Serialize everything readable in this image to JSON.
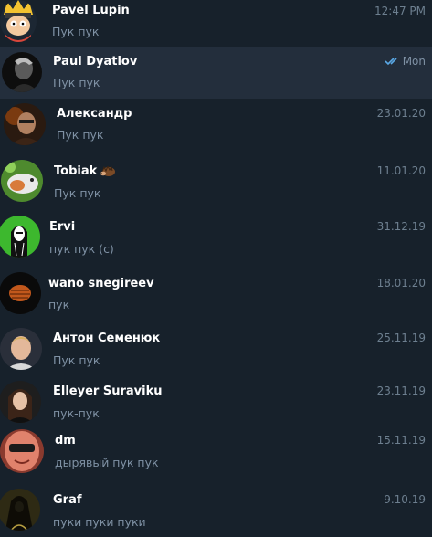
{
  "chats": [
    {
      "name": "Pavel Lupin",
      "message": "Пук пук",
      "time": "12:47 PM",
      "avatar": "cartoon-avatar"
    },
    {
      "name": "Paul Dyatlov",
      "message": "Пук пук",
      "time": "Mon",
      "avatar": "dark-portrait-avatar",
      "read_status": "double-check-icon"
    },
    {
      "name": "Александр",
      "message": "Пук пук",
      "time": "23.01.20",
      "avatar": "fire-portrait-avatar"
    },
    {
      "name": "Tobiak",
      "message": "Пук пук",
      "time": "11.01.20",
      "avatar": "bird-avatar",
      "name_emoji": "hedgehog-emoji"
    },
    {
      "name": "Ervi",
      "message": "пук пук (c)",
      "time": "31.12.19",
      "avatar": "green-figure-avatar"
    },
    {
      "name": "wano snegireev",
      "message": "пук",
      "time": "18.01.20",
      "avatar": "orange-orb-avatar"
    },
    {
      "name": "Антон Семенюк",
      "message": "Пук пук",
      "time": "25.11.19",
      "avatar": "blond-portrait-avatar"
    },
    {
      "name": "Elleyer Suraviku",
      "message": "пук-пук",
      "time": "23.11.19",
      "avatar": "woman-portrait-avatar"
    },
    {
      "name": "dm",
      "message": "дырявый пук пук",
      "time": "15.11.19",
      "avatar": "red-face-avatar"
    },
    {
      "name": "Graf",
      "message": "пуки пуки пуки",
      "time": "9.10.19",
      "avatar": "hooded-figure-avatar"
    }
  ],
  "colors": {
    "background": "#17212b",
    "selected_row": "#232e3c",
    "name_text": "#ffffff",
    "message_text": "#7f91a4",
    "time_text": "#6d7f8f",
    "check_accent": "#5aa9e6"
  }
}
